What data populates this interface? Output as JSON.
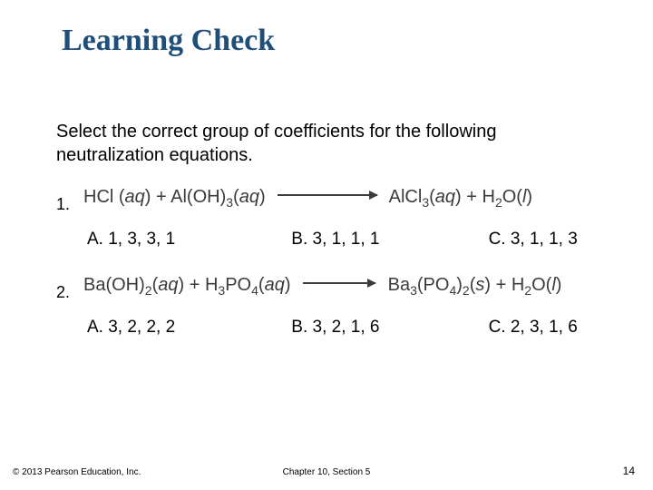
{
  "title": "Learning Check",
  "prompt": "Select the correct group of coefficients for the following neutralization equations.",
  "q1": {
    "num": "1.",
    "options": {
      "a": "A.  1, 3, 3, 1",
      "b": "B.  3, 1, 1, 1",
      "c": "C.  3, 1, 1, 3"
    }
  },
  "q2": {
    "num": "2.",
    "options": {
      "a": "A.  3, 2, 2, 2",
      "b": "B.  3, 2, 1, 6",
      "c": "C.  2, 3, 1, 6"
    }
  },
  "footer": {
    "left": "© 2013 Pearson Education, Inc.",
    "center": "Chapter 10, Section 5",
    "right": "14"
  },
  "chart_data": {
    "type": "table",
    "title": "Neutralization equation coefficient choices",
    "questions": [
      {
        "equation_plain": "HCl(aq) + Al(OH)3(aq) -> AlCl3(aq) + H2O(l)",
        "choices": [
          {
            "label": "A",
            "coefficients": [
              1,
              3,
              3,
              1
            ]
          },
          {
            "label": "B",
            "coefficients": [
              3,
              1,
              1,
              1
            ]
          },
          {
            "label": "C",
            "coefficients": [
              3,
              1,
              1,
              3
            ]
          }
        ]
      },
      {
        "equation_plain": "Ba(OH)2(aq) + H3PO4(aq) -> Ba3(PO4)2(s) + H2O(l)",
        "choices": [
          {
            "label": "A",
            "coefficients": [
              3,
              2,
              2,
              2
            ]
          },
          {
            "label": "B",
            "coefficients": [
              3,
              2,
              1,
              6
            ]
          },
          {
            "label": "C",
            "coefficients": [
              2,
              3,
              1,
              6
            ]
          }
        ]
      }
    ]
  }
}
